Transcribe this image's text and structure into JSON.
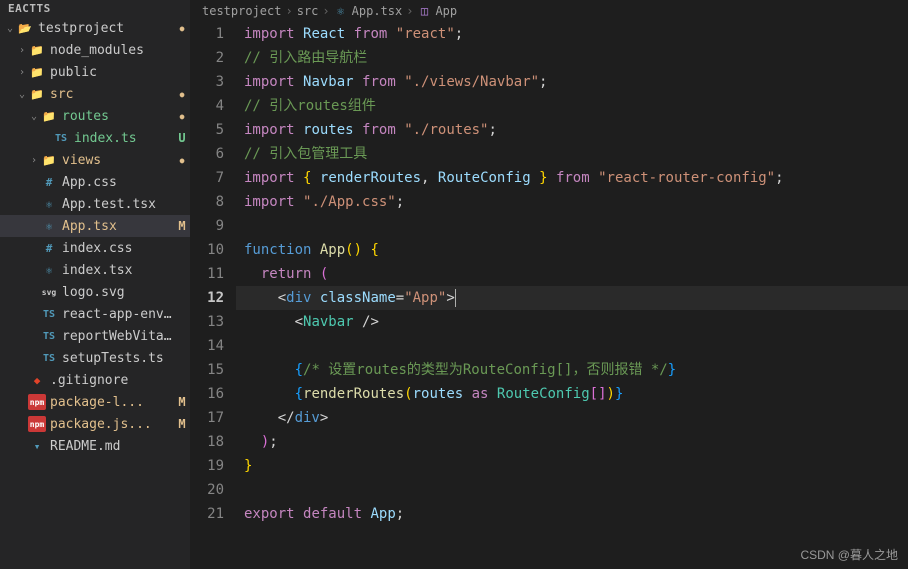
{
  "sidebar": {
    "header": "EACTTS",
    "items": [
      {
        "name": "testproject",
        "icon": "folder-open",
        "chev": "down",
        "indent": 0,
        "status": "dot",
        "class": ""
      },
      {
        "name": "node_modules",
        "icon": "folder",
        "chev": "right",
        "indent": 1,
        "status": "",
        "class": ""
      },
      {
        "name": "public",
        "icon": "folder",
        "chev": "right",
        "indent": 1,
        "status": "",
        "class": ""
      },
      {
        "name": "src",
        "icon": "folder-green",
        "chev": "down",
        "indent": 1,
        "status": "dot",
        "class": "modified-name"
      },
      {
        "name": "routes",
        "icon": "folder-teal",
        "chev": "down",
        "indent": 2,
        "status": "dot",
        "class": "untracked-name"
      },
      {
        "name": "index.ts",
        "icon": "ts",
        "chev": "",
        "indent": 3,
        "status": "U",
        "class": "untracked-name"
      },
      {
        "name": "views",
        "icon": "folder-red",
        "chev": "right",
        "indent": 2,
        "status": "dot",
        "class": "modified-name"
      },
      {
        "name": "App.css",
        "icon": "css",
        "chev": "",
        "indent": 2,
        "status": "",
        "class": ""
      },
      {
        "name": "App.test.tsx",
        "icon": "react",
        "chev": "",
        "indent": 2,
        "status": "",
        "class": ""
      },
      {
        "name": "App.tsx",
        "icon": "react",
        "chev": "",
        "indent": 2,
        "status": "M",
        "class": "modified-name",
        "active": true
      },
      {
        "name": "index.css",
        "icon": "css",
        "chev": "",
        "indent": 2,
        "status": "",
        "class": ""
      },
      {
        "name": "index.tsx",
        "icon": "react",
        "chev": "",
        "indent": 2,
        "status": "",
        "class": ""
      },
      {
        "name": "logo.svg",
        "icon": "svg",
        "chev": "",
        "indent": 2,
        "status": "",
        "class": ""
      },
      {
        "name": "react-app-env....",
        "icon": "ts",
        "chev": "",
        "indent": 2,
        "status": "",
        "class": ""
      },
      {
        "name": "reportWebVital...",
        "icon": "ts",
        "chev": "",
        "indent": 2,
        "status": "",
        "class": ""
      },
      {
        "name": "setupTests.ts",
        "icon": "ts",
        "chev": "",
        "indent": 2,
        "status": "",
        "class": ""
      },
      {
        "name": ".gitignore",
        "icon": "git",
        "chev": "",
        "indent": 1,
        "status": "",
        "class": ""
      },
      {
        "name": "package-l...",
        "icon": "npm",
        "chev": "",
        "indent": 1,
        "status": "M",
        "class": "modified-name"
      },
      {
        "name": "package.js...",
        "icon": "npm",
        "chev": "",
        "indent": 1,
        "status": "M",
        "class": "modified-name"
      },
      {
        "name": "README.md",
        "icon": "md",
        "chev": "",
        "indent": 1,
        "status": "",
        "class": ""
      }
    ]
  },
  "breadcrumb": {
    "parts": [
      "testproject",
      "src",
      "App.tsx",
      "App"
    ]
  },
  "code": {
    "current_line": 12,
    "lines": [
      {
        "n": 1,
        "html": "<span class='tk-kw'>import</span> <span class='tk-var'>React</span> <span class='tk-kw'>from</span> <span class='tk-str'>\"react\"</span><span class='tk-punc'>;</span>"
      },
      {
        "n": 2,
        "html": "<span class='tk-com'>// 引入路由导航栏</span>"
      },
      {
        "n": 3,
        "html": "<span class='tk-kw'>import</span> <span class='tk-var'>Navbar</span> <span class='tk-kw'>from</span> <span class='tk-str'>\"./views/Navbar\"</span><span class='tk-punc'>;</span>"
      },
      {
        "n": 4,
        "html": "<span class='tk-com'>// 引入routes组件</span>"
      },
      {
        "n": 5,
        "html": "<span class='tk-kw'>import</span> <span class='tk-var'>routes</span> <span class='tk-kw'>from</span> <span class='tk-str'>\"./routes\"</span><span class='tk-punc'>;</span>"
      },
      {
        "n": 6,
        "html": "<span class='tk-com'>// 引入包管理工具</span>"
      },
      {
        "n": 7,
        "html": "<span class='tk-kw'>import</span> <span class='tk-brace1'>{</span> <span class='tk-var'>renderRoutes</span><span class='tk-punc'>,</span> <span class='tk-var'>RouteConfig</span> <span class='tk-brace1'>}</span> <span class='tk-kw'>from</span> <span class='tk-str'>\"react-router-config\"</span><span class='tk-punc'>;</span>"
      },
      {
        "n": 8,
        "html": "<span class='tk-kw'>import</span> <span class='tk-str'>\"./App.css\"</span><span class='tk-punc'>;</span>"
      },
      {
        "n": 9,
        "html": ""
      },
      {
        "n": 10,
        "html": "<span class='tk-tag'>function</span> <span class='tk-fn'>App</span><span class='tk-brace1'>()</span> <span class='tk-brace1'>{</span>"
      },
      {
        "n": 11,
        "html": "  <span class='tk-kw'>return</span> <span class='tk-brace2'>(</span>"
      },
      {
        "n": 12,
        "html": "    <span class='tk-punc'>&lt;</span><span class='tk-tag'>div</span> <span class='tk-attr'>className</span><span class='tk-punc'>=</span><span class='tk-str'>\"App\"</span><span class='tk-punc'>&gt;</span><span class='cursor'></span>"
      },
      {
        "n": 13,
        "html": "      <span class='tk-punc'>&lt;</span><span class='tk-tagname'>Navbar</span> <span class='tk-punc'>/&gt;</span>"
      },
      {
        "n": 14,
        "html": ""
      },
      {
        "n": 15,
        "html": "      <span class='tk-brace3'>{</span><span class='tk-com'>/* 设置routes的类型为RouteConfig[]，否则报错 */</span><span class='tk-brace3'>}</span>"
      },
      {
        "n": 16,
        "html": "      <span class='tk-brace3'>{</span><span class='tk-fn'>renderRoutes</span><span class='tk-brace1'>(</span><span class='tk-var'>routes</span> <span class='tk-kw'>as</span> <span class='tk-type'>RouteConfig</span><span class='tk-brace2'>[]</span><span class='tk-brace1'>)</span><span class='tk-brace3'>}</span>"
      },
      {
        "n": 17,
        "html": "    <span class='tk-punc'>&lt;/</span><span class='tk-tag'>div</span><span class='tk-punc'>&gt;</span>"
      },
      {
        "n": 18,
        "html": "  <span class='tk-brace2'>)</span><span class='tk-punc'>;</span>"
      },
      {
        "n": 19,
        "html": "<span class='tk-brace1'>}</span>"
      },
      {
        "n": 20,
        "html": ""
      },
      {
        "n": 21,
        "html": "<span class='tk-kw'>export</span> <span class='tk-kw'>default</span> <span class='tk-var'>App</span><span class='tk-punc'>;</span>"
      }
    ]
  },
  "watermark": "CSDN @暮人之地"
}
